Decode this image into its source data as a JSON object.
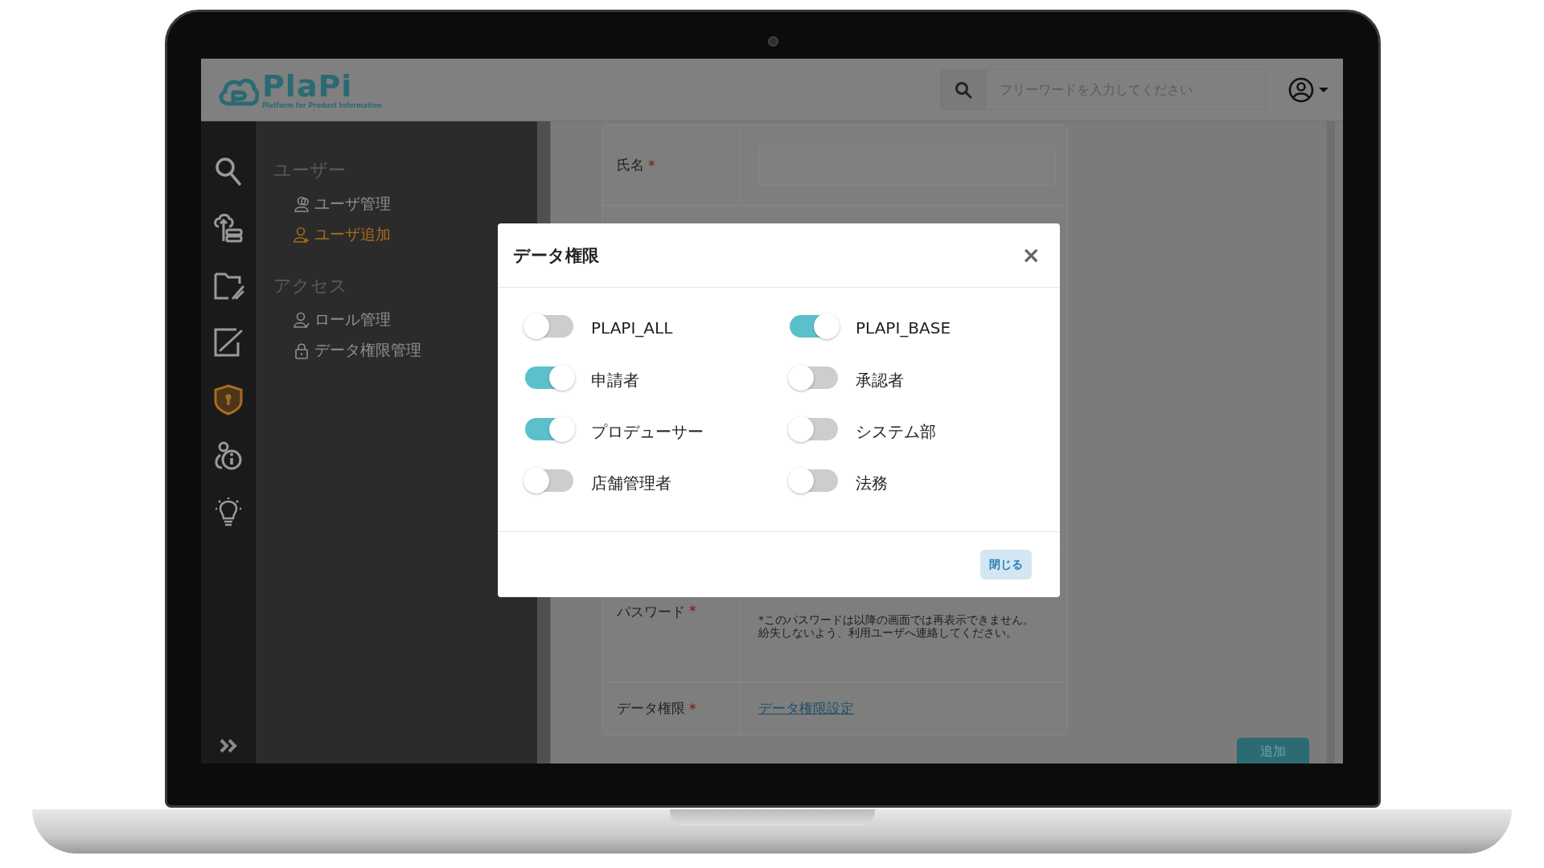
{
  "header": {
    "logo": "PlaPi",
    "tagline": "Platform for Product Information",
    "search": {
      "placeholder": "フリーワードを入力してください"
    }
  },
  "rail": [
    {
      "selected": false
    },
    {
      "selected": false
    },
    {
      "selected": false
    },
    {
      "selected": false
    },
    {
      "selected": true
    },
    {
      "selected": false
    },
    {
      "selected": false
    }
  ],
  "menu": [
    {
      "title": "ユーザー",
      "items": [
        {
          "label": "ユーザ管理",
          "selected": false
        },
        {
          "label": "ユーザ追加",
          "selected": true
        }
      ]
    },
    {
      "title": "アクセス",
      "items": [
        {
          "label": "ロール管理",
          "selected": false
        },
        {
          "label": "データ権限管理",
          "selected": false
        }
      ]
    }
  ],
  "form": {
    "rows": [
      {
        "kind": "input",
        "label": "氏名",
        "mark": "*"
      },
      {
        "kind": "note",
        "label": "パスワード",
        "mark": "*",
        "note": "*このパスワードは以降の画面では再表示できません。紛失しないよう、利用ユーザへ連絡してください。"
      },
      {
        "kind": "link",
        "label": "データ権限",
        "mark": "*",
        "link": "データ権限設定"
      }
    ],
    "submit": "追加"
  },
  "modal": {
    "title": "データ権限",
    "close": "×",
    "toggles": [
      {
        "label": "PLAPI_ALL",
        "on": false
      },
      {
        "label": "PLAPI_BASE",
        "on": true
      },
      {
        "label": "申請者",
        "on": true
      },
      {
        "label": "承認者",
        "on": false
      },
      {
        "label": "プロデューサー",
        "on": true
      },
      {
        "label": "システム部",
        "on": false
      },
      {
        "label": "店舗管理者",
        "on": false
      },
      {
        "label": "法務",
        "on": false
      }
    ],
    "button": "閉じる"
  }
}
